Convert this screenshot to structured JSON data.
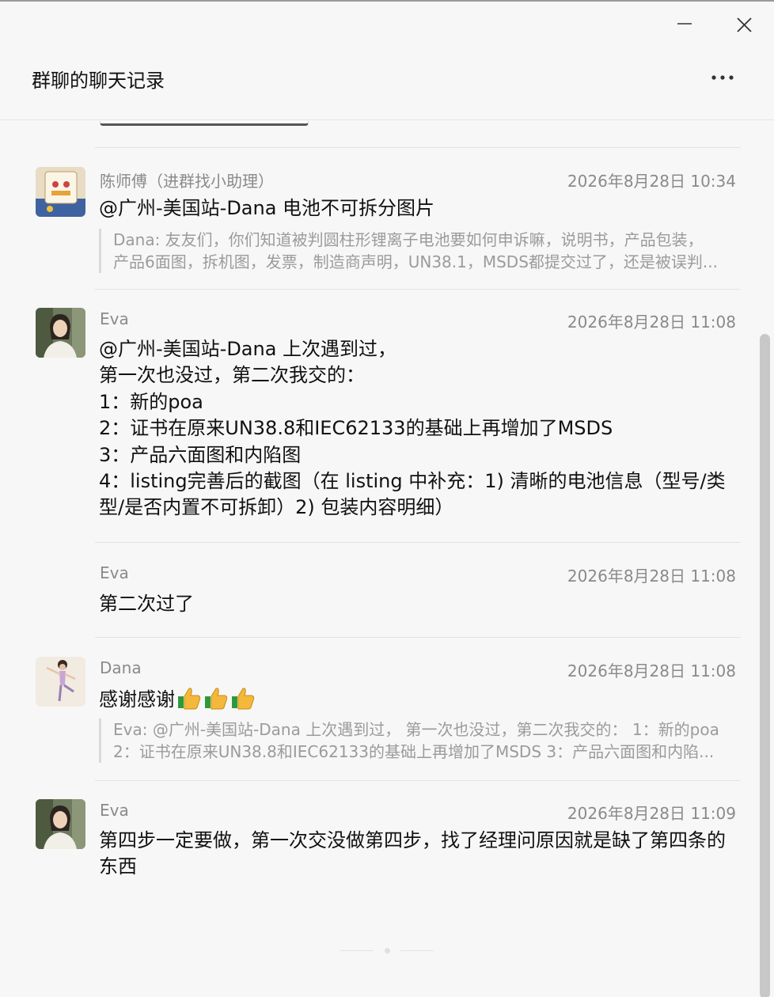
{
  "window": {
    "title": "群聊的聊天记录",
    "minimize_icon": "minimize-icon",
    "close_icon": "close-icon",
    "more_icon": "more-icon"
  },
  "messages": [
    {
      "sender": "陈师傅（进群找小助理）",
      "time": "2026年8月28日 10:34",
      "content": "@广州-美国站-Dana 电池不可拆分图片",
      "quote": [
        "Dana: 友友们，你们知道被判圆柱形锂离子电池要如何申诉嘛，说明书，产品包装，",
        "产品6面图，拆机图，发票，制造商声明，UN38.1，MSDS都提交过了，还是被误判..."
      ]
    },
    {
      "sender": "Eva",
      "time": "2026年8月28日 11:08",
      "content": "@广州-美国站-Dana 上次遇到过，\n第一次也没过，第二次我交的：\n1：新的poa\n2：证书在原来UN38.8和IEC62133的基础上再增加了MSDS\n3：产品六面图和内陷图\n4：listing完善后的截图（在 listing 中补充：1) 清晰的电池信息（型号/类\n型/是否内置不可拆卸）2) 包装内容明细）"
    },
    {
      "sender": "Eva",
      "time": "2026年8月28日 11:08",
      "content": "第二次过了"
    },
    {
      "sender": "Dana",
      "time": "2026年8月28日 11:08",
      "content": "感谢感谢",
      "quote": [
        "Eva: @广州-美国站-Dana 上次遇到过， 第一次也没过，第二次我交的： 1：新的poa",
        "2：证书在原来UN38.8和IEC62133的基础上再增加了MSDS 3：产品六面图和内陷..."
      ]
    },
    {
      "sender": "Eva",
      "time": "2026年8月28日 11:09",
      "content": "第四步一定要做，第一次交没做第四步，找了经理问原因就是缺了第四条的\n东西"
    }
  ],
  "colors": {
    "background": "#f7f7f7",
    "meta_text": "#8a8a8a",
    "quote_text": "#9b9b9b",
    "divider": "#e3e3e3"
  }
}
